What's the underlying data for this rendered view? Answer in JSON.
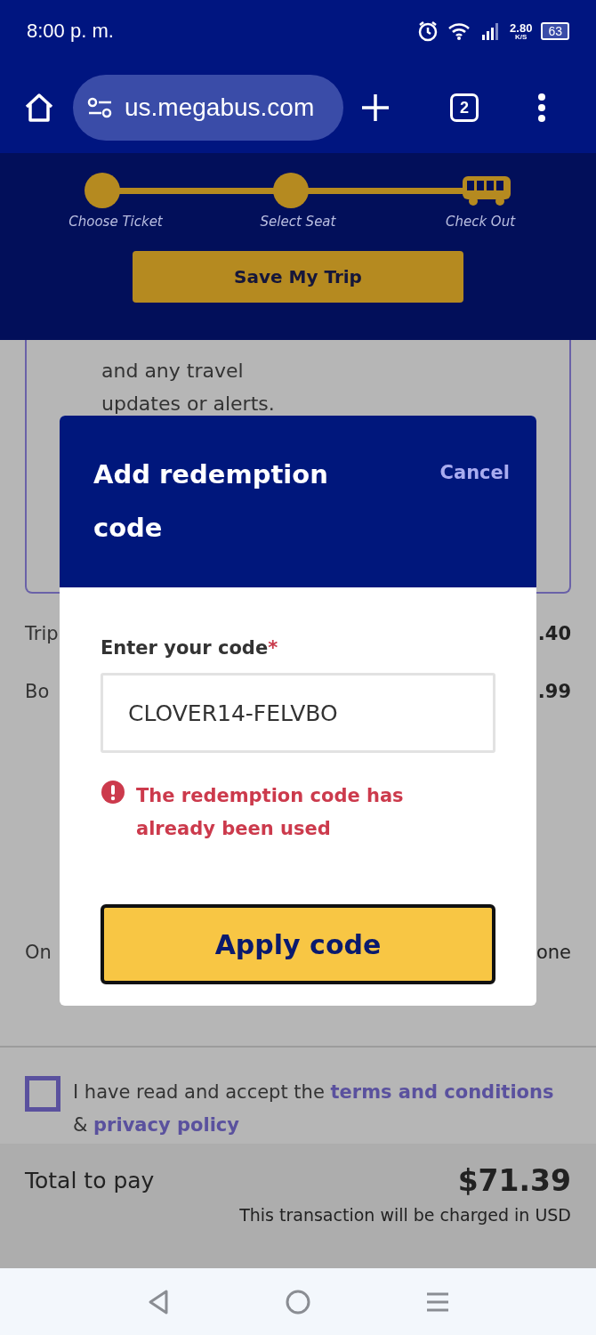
{
  "status_bar": {
    "time": "8:00 p. m.",
    "net_speed": "2.80",
    "net_unit": "K/S",
    "battery": "63"
  },
  "browser": {
    "url": "us.megabus.com",
    "tab_count": "2"
  },
  "progress": {
    "steps": [
      {
        "label": "Choose Ticket",
        "kind": "dot"
      },
      {
        "label": "Select Seat",
        "kind": "dot"
      },
      {
        "label": "Check Out",
        "kind": "bus"
      }
    ],
    "save_button": "Save My Trip"
  },
  "background": {
    "card_lines": [
      "and any travel",
      "updates or alerts."
    ],
    "rows": [
      {
        "label": "Trip",
        "value": ".40"
      },
      {
        "label": "Bo",
        "value": ".99"
      },
      {
        "label": "On",
        "value": "one"
      }
    ]
  },
  "modal": {
    "title": "Add redemption code",
    "cancel": "Cancel",
    "field_label": "Enter your code",
    "required_mark": "*",
    "value": "CLOVER14-FELVBO",
    "error": "The redemption code has already been used",
    "apply_button": "Apply code"
  },
  "terms": {
    "checked": false,
    "text": "I have read and accept the",
    "link_terms": "terms and conditions",
    "joiner": "&",
    "link_privacy": "privacy policy"
  },
  "total": {
    "label": "Total to pay",
    "amount": "$71.39",
    "note": "This transaction will be charged in USD"
  }
}
